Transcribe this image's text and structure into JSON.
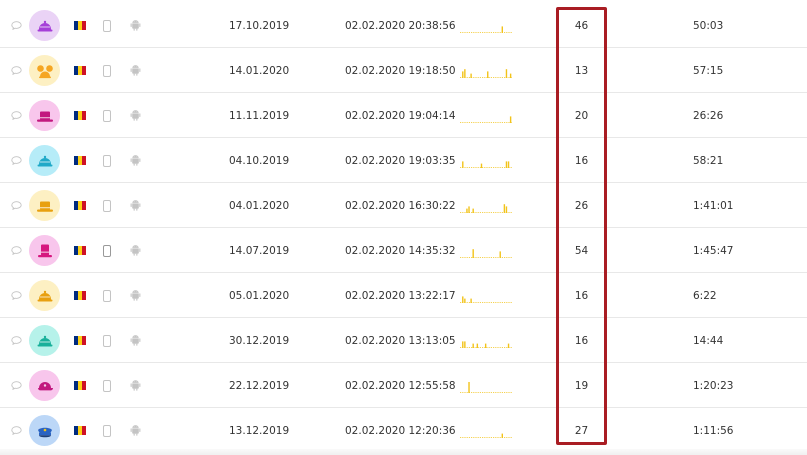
{
  "colors": {
    "highlight_border": "#a91d23",
    "sparkline": "#f2c31a",
    "flag_blue": "#002b7f",
    "flag_yellow": "#fcd116",
    "flag_red": "#ce1126"
  },
  "icons": {
    "chat": "chat-bubble-icon",
    "device": "phone-icon",
    "os": "android-icon",
    "country": "romania-flag-icon"
  },
  "visitors": [
    {
      "avatar": {
        "bg": "#ead3f6",
        "fg": "#a53ed8",
        "shape": "dome-hat"
      },
      "first_visit": "17.10.2019",
      "last_visit": "02.02.2020 20:38:56",
      "sessions": "46",
      "time_spent": "50:03",
      "activity": [
        0,
        0,
        0,
        0,
        0,
        0,
        0,
        0,
        0,
        0,
        0,
        0,
        0,
        0,
        0,
        0,
        0,
        0,
        0,
        0,
        3,
        0,
        0,
        0,
        0
      ]
    },
    {
      "avatar": {
        "bg": "#fdf0c3",
        "fg": "#f5a623",
        "shape": "mouse-ears"
      },
      "first_visit": "14.01.2020",
      "last_visit": "02.02.2020 19:18:50",
      "sessions": "13",
      "time_spent": "57:15",
      "activity": [
        0,
        3,
        4,
        0,
        0,
        2,
        0,
        0,
        0,
        0,
        0,
        0,
        0,
        3,
        0,
        0,
        0,
        0,
        0,
        0,
        0,
        0,
        4,
        0,
        2
      ]
    },
    {
      "avatar": {
        "bg": "#f8c6ec",
        "fg": "#c2187f",
        "shape": "top-hat"
      },
      "first_visit": "11.11.2019",
      "last_visit": "02.02.2020 19:04:14",
      "sessions": "20",
      "time_spent": "26:26",
      "activity": [
        0,
        0,
        0,
        0,
        0,
        0,
        0,
        0,
        0,
        0,
        0,
        0,
        0,
        0,
        0,
        0,
        0,
        0,
        0,
        0,
        0,
        0,
        0,
        0,
        3
      ]
    },
    {
      "avatar": {
        "bg": "#b6ecf8",
        "fg": "#20a9c8",
        "shape": "dome-hat"
      },
      "first_visit": "04.10.2019",
      "last_visit": "02.02.2020 19:03:35",
      "sessions": "16",
      "time_spent": "58:21",
      "activity": [
        0,
        3,
        0,
        0,
        0,
        0,
        0,
        0,
        0,
        0,
        2,
        0,
        0,
        0,
        0,
        0,
        0,
        0,
        0,
        0,
        0,
        0,
        3,
        3,
        0
      ]
    },
    {
      "avatar": {
        "bg": "#fdf0c3",
        "fg": "#e8a010",
        "shape": "top-hat"
      },
      "first_visit": "04.01.2020",
      "last_visit": "02.02.2020 16:30:22",
      "sessions": "26",
      "time_spent": "1:41:01",
      "activity": [
        0,
        0,
        0,
        2,
        3,
        0,
        2,
        0,
        0,
        0,
        0,
        0,
        0,
        0,
        0,
        0,
        0,
        0,
        0,
        0,
        0,
        4,
        3,
        0,
        0
      ]
    },
    {
      "avatar": {
        "bg": "#f8c6ec",
        "fg": "#d6177f",
        "shape": "tall-hat"
      },
      "first_visit": "14.07.2019",
      "last_visit": "02.02.2020 14:35:32",
      "sessions": "54",
      "time_spent": "1:45:47",
      "activity": [
        0,
        0,
        0,
        0,
        0,
        0,
        4,
        0,
        0,
        0,
        0,
        0,
        0,
        0,
        0,
        0,
        0,
        0,
        0,
        3,
        0,
        0,
        0,
        0,
        0
      ]
    },
    {
      "avatar": {
        "bg": "#fdf0c3",
        "fg": "#e8a010",
        "shape": "dome-hat"
      },
      "first_visit": "05.01.2020",
      "last_visit": "02.02.2020 13:22:17",
      "sessions": "16",
      "time_spent": "6:22",
      "activity": [
        0,
        3,
        2,
        0,
        0,
        2,
        0,
        0,
        0,
        0,
        0,
        0,
        0,
        0,
        0,
        0,
        0,
        0,
        0,
        0,
        0,
        0,
        0,
        0,
        0
      ]
    },
    {
      "avatar": {
        "bg": "#b6f2ea",
        "fg": "#18b09a",
        "shape": "dome-hat"
      },
      "first_visit": "30.12.2019",
      "last_visit": "02.02.2020 13:13:05",
      "sessions": "16",
      "time_spent": "14:44",
      "activity": [
        0,
        3,
        3,
        0,
        0,
        0,
        2,
        0,
        2,
        0,
        0,
        0,
        2,
        0,
        0,
        0,
        0,
        0,
        0,
        0,
        0,
        0,
        0,
        2,
        0
      ]
    },
    {
      "avatar": {
        "bg": "#f8c6ec",
        "fg": "#c2187f",
        "shape": "cap"
      },
      "first_visit": "22.12.2019",
      "last_visit": "02.02.2020 12:55:58",
      "sessions": "19",
      "time_spent": "1:20:23",
      "activity": [
        0,
        0,
        0,
        0,
        5,
        0,
        0,
        0,
        0,
        0,
        0,
        0,
        0,
        0,
        0,
        0,
        0,
        0,
        0,
        0,
        0,
        0,
        0,
        0,
        0
      ]
    },
    {
      "avatar": {
        "bg": "#bcd7f7",
        "fg": "#2a63c2",
        "shape": "police-cap"
      },
      "first_visit": "13.12.2019",
      "last_visit": "02.02.2020 12:20:36",
      "sessions": "27",
      "time_spent": "1:11:56",
      "activity": [
        0,
        0,
        0,
        0,
        0,
        0,
        0,
        0,
        0,
        0,
        0,
        0,
        0,
        0,
        0,
        0,
        0,
        0,
        0,
        0,
        2,
        0,
        0,
        0,
        0
      ]
    }
  ]
}
